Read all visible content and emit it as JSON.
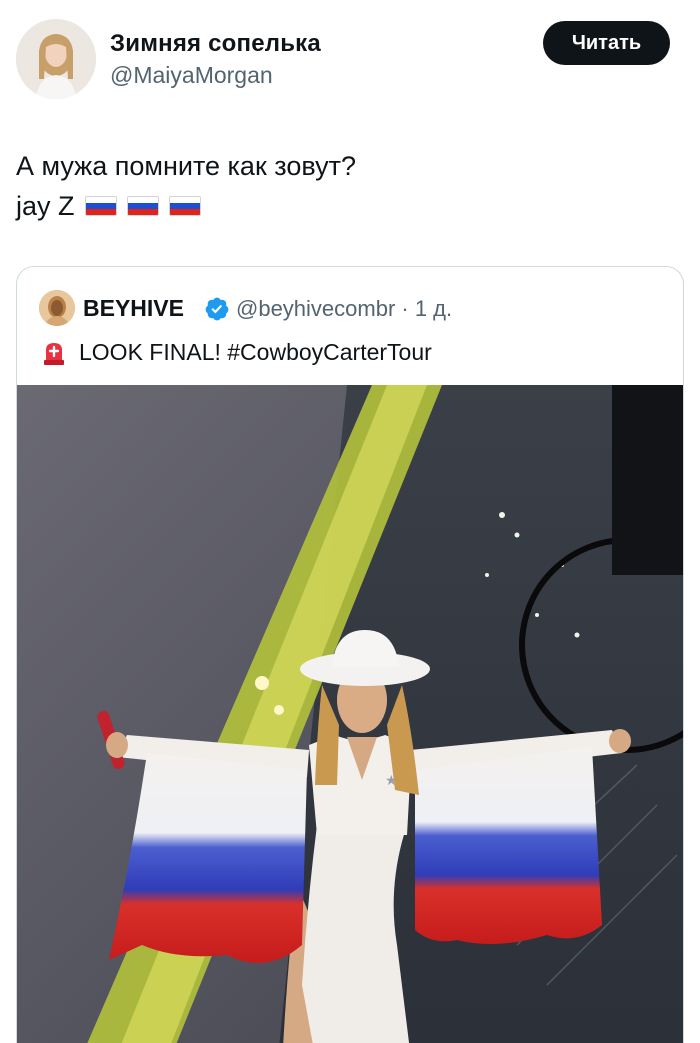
{
  "author": {
    "display_name": "Зимняя сопелька",
    "handle": "@MaiyaMorgan",
    "follow_label": "Читать"
  },
  "tweet": {
    "line1": "А мужа помните как зовут?",
    "line2": "jay Z"
  },
  "quoted": {
    "name": "BEYHIVE",
    "handle_meta": "@beyhivecombr · 1 д.",
    "text": "LOOK FINAL! #CowboyCarterTour"
  },
  "icons": {
    "verified": "verified-badge-icon",
    "siren": "rotating-light-icon",
    "flag": "russia-flag-icon"
  },
  "colors": {
    "follow_bg": "#0f1419",
    "verified": "#1d9bf0",
    "secondary_text": "#536471",
    "border": "#cfd9de"
  }
}
